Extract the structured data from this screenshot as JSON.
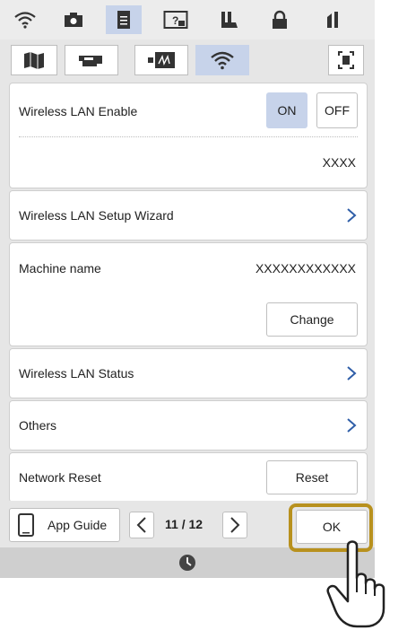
{
  "icons": {
    "top_tabs": [
      "wifi-icon",
      "camera-icon",
      "document-icon",
      "help-icon",
      "needle-icon",
      "lock-icon",
      "sewing-foot-icon"
    ],
    "sub_tabs": [
      "map-icon",
      "machine-icon",
      "screen-icon",
      "wifi-icon",
      "fullscreen-icon"
    ]
  },
  "wireless_lan_enable": {
    "label": "Wireless LAN Enable",
    "on": "ON",
    "off": "OFF",
    "state": "ON"
  },
  "ssid": {
    "value": "XXXX"
  },
  "setup_wizard": {
    "label": "Wireless LAN Setup Wizard"
  },
  "machine_name": {
    "label": "Machine name",
    "value": "XXXXXXXXXXXX",
    "change_button": "Change"
  },
  "lan_status": {
    "label": "Wireless LAN Status"
  },
  "others": {
    "label": "Others"
  },
  "network_reset": {
    "label": "Network Reset",
    "button": "Reset"
  },
  "bottom": {
    "app_guide": "App Guide",
    "page": "11 / 12",
    "ok": "OK"
  },
  "colors": {
    "accent": "#c7d3ea",
    "highlight": "#b8911e",
    "chevron": "#2f5ea8"
  }
}
